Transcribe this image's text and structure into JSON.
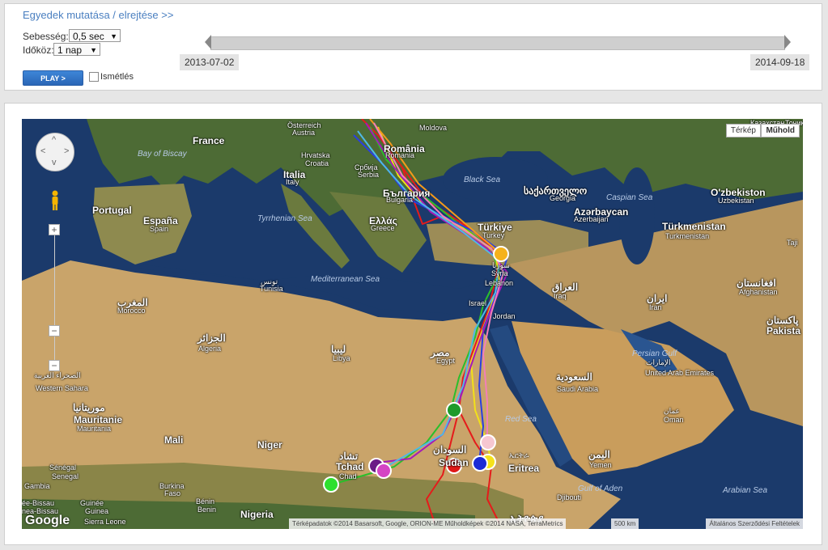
{
  "controls": {
    "toggle_link": "Egyedek mutatása / elrejtése >>",
    "speed_label": "Sebesség:",
    "speed_value": "0,5 sec",
    "interval_label": "Időköz:",
    "interval_value": "1 nap",
    "play_label": "PLAY >",
    "repeat_label": "Ismétlés",
    "start_date": "2013-07-02",
    "end_date": "2014-09-18"
  },
  "map": {
    "type_buttons": [
      "Térkép",
      "Műhold"
    ],
    "scale": "500 km",
    "data_credits": "Térképadatok ©2014 Basarsoft, Google, ORION-ME Műholdképek ©2014 NASA, TerraMetrics",
    "terms": "Általános Szerződési Feltételek",
    "logo": "Google",
    "colors": {
      "land": "#c9a46a",
      "sea": "#1b3a6b",
      "forest": "#4d6b35"
    },
    "labels": [
      {
        "text": "France",
        "cls": "big"
      },
      {
        "text": "Österreich",
        "cls": "small"
      },
      {
        "text": "Austria",
        "cls": "small"
      },
      {
        "text": "Moldova",
        "cls": "small"
      },
      {
        "text": "Bay of Biscay",
        "cls": "sea"
      },
      {
        "text": "România",
        "cls": "big"
      },
      {
        "text": "Romania",
        "cls": "small"
      },
      {
        "text": "Hrvatska",
        "cls": "small"
      },
      {
        "text": "Croatia",
        "cls": "small"
      },
      {
        "text": "Србија",
        "cls": "small"
      },
      {
        "text": "Serbia",
        "cls": "small"
      },
      {
        "text": "Black Sea",
        "cls": "sea"
      },
      {
        "text": "საქართველო",
        "cls": "big"
      },
      {
        "text": "Georgia",
        "cls": "small"
      },
      {
        "text": "Caspian Sea",
        "cls": "sea"
      },
      {
        "text": "O'zbekiston",
        "cls": "big"
      },
      {
        "text": "Uzbekistan",
        "cls": "small"
      },
      {
        "text": "Italia",
        "cls": "big"
      },
      {
        "text": "Italy",
        "cls": "small"
      },
      {
        "text": "България",
        "cls": "big"
      },
      {
        "text": "Bulgaria",
        "cls": "small"
      },
      {
        "text": "Azərbaycan",
        "cls": "big"
      },
      {
        "text": "Azerbaijan",
        "cls": "small"
      },
      {
        "text": "Portugal",
        "cls": "big"
      },
      {
        "text": "España",
        "cls": "big"
      },
      {
        "text": "Spain",
        "cls": "small"
      },
      {
        "text": "Tyrrhenian Sea",
        "cls": "sea"
      },
      {
        "text": "Ελλάς",
        "cls": "big"
      },
      {
        "text": "Greece",
        "cls": "small"
      },
      {
        "text": "Türkmenistan",
        "cls": "big"
      },
      {
        "text": "Turkmenistan",
        "cls": "small"
      },
      {
        "text": "Türkiye",
        "cls": "big"
      },
      {
        "text": "Turkey",
        "cls": "small"
      },
      {
        "text": "تونس",
        "cls": "small"
      },
      {
        "text": "Tunisia",
        "cls": "small"
      },
      {
        "text": "Mediterranean Sea",
        "cls": "sea"
      },
      {
        "text": "سوريا",
        "cls": "small"
      },
      {
        "text": "Syria",
        "cls": "small"
      },
      {
        "text": "Lebanon",
        "cls": "small"
      },
      {
        "text": "افغانستان",
        "cls": "big"
      },
      {
        "text": "Afghanistan",
        "cls": "small"
      },
      {
        "text": "المغرب",
        "cls": "big"
      },
      {
        "text": "Morocco",
        "cls": "small"
      },
      {
        "text": "العراق",
        "cls": "big"
      },
      {
        "text": "Iraq",
        "cls": "small"
      },
      {
        "text": "ایران",
        "cls": "big"
      },
      {
        "text": "Iran",
        "cls": "small"
      },
      {
        "text": "Israel",
        "cls": "small"
      },
      {
        "text": "Jordan",
        "cls": "small"
      },
      {
        "text": "پاکستان",
        "cls": "big"
      },
      {
        "text": "Pakista",
        "cls": "big"
      },
      {
        "text": "الجزائر",
        "cls": "big"
      },
      {
        "text": "Algeria",
        "cls": "small"
      },
      {
        "text": "ليبيا",
        "cls": "big"
      },
      {
        "text": "Libya",
        "cls": "small"
      },
      {
        "text": "مصر",
        "cls": "big"
      },
      {
        "text": "Egypt",
        "cls": "small"
      },
      {
        "text": "Persian Gulf",
        "cls": "sea"
      },
      {
        "text": "الصحراء الغربية",
        "cls": "small"
      },
      {
        "text": "Western Sahara",
        "cls": "small"
      },
      {
        "text": "السعودية",
        "cls": "big"
      },
      {
        "text": "Saudi Arabia",
        "cls": "small"
      },
      {
        "text": "الإمارات",
        "cls": "small"
      },
      {
        "text": "United Arab Emirates",
        "cls": "small"
      },
      {
        "text": "موريتانيا",
        "cls": "big"
      },
      {
        "text": "Mauritanie",
        "cls": "big"
      },
      {
        "text": "Mauritania",
        "cls": "small"
      },
      {
        "text": "Red Sea",
        "cls": "sea"
      },
      {
        "text": "عمان",
        "cls": "small"
      },
      {
        "text": "Oman",
        "cls": "small"
      },
      {
        "text": "Mali",
        "cls": "big"
      },
      {
        "text": "Niger",
        "cls": "big"
      },
      {
        "text": "تشاد",
        "cls": "big"
      },
      {
        "text": "Tchad",
        "cls": "big"
      },
      {
        "text": "Chad",
        "cls": "small"
      },
      {
        "text": "السودان",
        "cls": "big"
      },
      {
        "text": "Sudan",
        "cls": "big"
      },
      {
        "text": "ኤርትራ",
        "cls": "small"
      },
      {
        "text": "Eritrea",
        "cls": "big"
      },
      {
        "text": "اليمن",
        "cls": "big"
      },
      {
        "text": "Yemen",
        "cls": "small"
      },
      {
        "text": "Sénégal",
        "cls": "small"
      },
      {
        "text": "Senegal",
        "cls": "small"
      },
      {
        "text": "Gambia",
        "cls": "small"
      },
      {
        "text": "Burkina",
        "cls": "small"
      },
      {
        "text": "Faso",
        "cls": "small"
      },
      {
        "text": "Gulf of Aden",
        "cls": "sea"
      },
      {
        "text": "Djibouti",
        "cls": "small"
      },
      {
        "text": "Arabian Sea",
        "cls": "sea"
      },
      {
        "text": "Guinée",
        "cls": "small"
      },
      {
        "text": "Guinea",
        "cls": "small"
      },
      {
        "text": "Bénin",
        "cls": "small"
      },
      {
        "text": "Benin",
        "cls": "small"
      },
      {
        "text": "Nigeria",
        "cls": "big"
      },
      {
        "text": "ée-Bissau",
        "cls": "small"
      },
      {
        "text": "nea-Bissau",
        "cls": "small"
      },
      {
        "text": "Sierra Leone",
        "cls": "small"
      },
      {
        "text": "ኢትዮጵያ",
        "cls": "big"
      },
      {
        "text": "Казахстан",
        "cls": "small"
      },
      {
        "text": "Тоҷикистон",
        "cls": "small"
      },
      {
        "text": "Taji",
        "cls": "small"
      }
    ],
    "markers": [
      {
        "name": "bird-marker-orange",
        "color": "#f5b21b"
      },
      {
        "name": "bird-marker-green",
        "color": "#1f9a2c"
      },
      {
        "name": "bird-marker-pink-light",
        "color": "#f6c7d1"
      },
      {
        "name": "bird-marker-yellow",
        "color": "#f5e21b"
      },
      {
        "name": "bird-marker-blue",
        "color": "#1b2ad6"
      },
      {
        "name": "bird-marker-red",
        "color": "#e01818"
      },
      {
        "name": "bird-marker-purple",
        "color": "#6a1a86"
      },
      {
        "name": "bird-marker-magenta",
        "color": "#d444c4"
      },
      {
        "name": "bird-marker-lime",
        "color": "#2ee02e"
      }
    ],
    "tracks": [
      {
        "name": "track-red",
        "color": "#e51b1b"
      },
      {
        "name": "track-green",
        "color": "#2bbf2b"
      },
      {
        "name": "track-yellow",
        "color": "#f2e01a"
      },
      {
        "name": "track-blue",
        "color": "#2a3fe0"
      },
      {
        "name": "track-purple",
        "color": "#a41ab8"
      },
      {
        "name": "track-lightblue",
        "color": "#4fb8e6"
      },
      {
        "name": "track-orange",
        "color": "#f59a1a"
      },
      {
        "name": "track-pink",
        "color": "#f27fb8"
      }
    ]
  }
}
